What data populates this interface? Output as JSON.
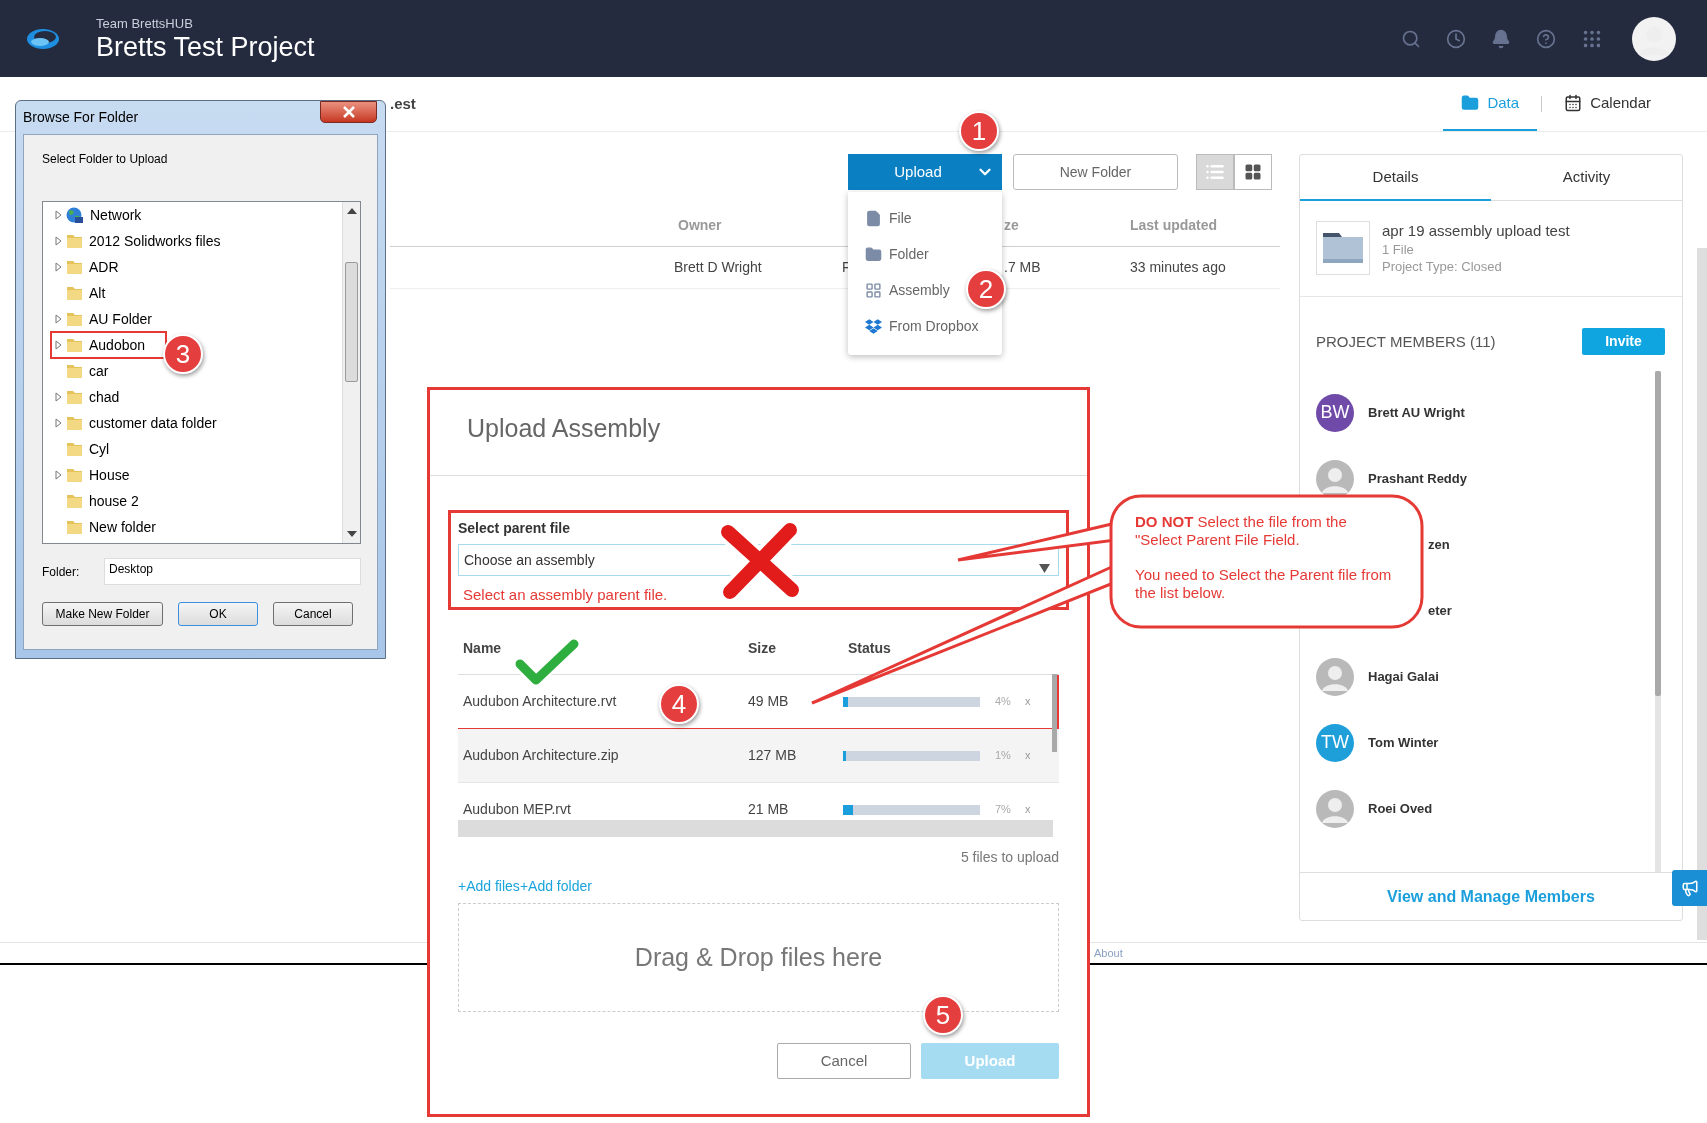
{
  "header": {
    "team": "Team BrettsHUB",
    "project": "Bretts Test Project"
  },
  "subheader": {
    "title_fragment": ".est",
    "tabs": [
      {
        "label": "Data",
        "selected": true
      },
      {
        "label": "Calendar",
        "selected": false
      }
    ]
  },
  "toolbar": {
    "upload": "Upload",
    "new_folder": "New Folder",
    "views": [
      {
        "kind": "list",
        "selected": true
      },
      {
        "kind": "grid",
        "selected": false
      }
    ]
  },
  "upload_menu": [
    {
      "kind": "file",
      "label": "File"
    },
    {
      "kind": "folder",
      "label": "Folder"
    },
    {
      "kind": "assembly",
      "label": "Assembly"
    },
    {
      "kind": "dropbox",
      "label": "From Dropbox"
    }
  ],
  "table": {
    "columns": [
      "Owner",
      "",
      "ze",
      "Last updated"
    ],
    "rows": [
      {
        "cells": [
          "Brett D Wright",
          "F",
          ".7 MB",
          "33 minutes ago"
        ]
      }
    ]
  },
  "details_panel": {
    "tabs": [
      {
        "label": "Details",
        "selected": true
      },
      {
        "label": "Activity",
        "selected": false
      }
    ],
    "item": {
      "title": "apr 19 assembly upload test",
      "files": "1 File",
      "type": "Project Type: Closed"
    },
    "members_heading": "PROJECT MEMBERS (11)",
    "invite": "Invite",
    "members": [
      {
        "name": "Brett AU Wright",
        "kind": "initials",
        "initials": "BW",
        "color": "#6f4aa8"
      },
      {
        "name": "Prashant Reddy",
        "kind": "photo"
      },
      {
        "name": "zen",
        "kind": "covered"
      },
      {
        "name": "eter",
        "kind": "covered"
      },
      {
        "name": "Hagai Galai",
        "kind": "photo"
      },
      {
        "name": "Tom Winter",
        "kind": "initials",
        "initials": "TW",
        "color": "#1e9fd9"
      },
      {
        "name": "Roei Oved",
        "kind": "photo"
      }
    ],
    "manage_link": "View and Manage Members"
  },
  "browse_dialog": {
    "title": "Browse For Folder",
    "prompt": "Select Folder to Upload",
    "tree": [
      {
        "label": "Network",
        "kind": "network",
        "expandable": true,
        "marked": false
      },
      {
        "label": "2012 Solidworks files",
        "kind": "folder",
        "expandable": true,
        "marked": false
      },
      {
        "label": "ADR",
        "kind": "folder",
        "expandable": true,
        "marked": false
      },
      {
        "label": "Alt",
        "kind": "folder",
        "expandable": false,
        "marked": false
      },
      {
        "label": "AU Folder",
        "kind": "folder",
        "expandable": true,
        "marked": false
      },
      {
        "label": "Audobon",
        "kind": "folder",
        "expandable": true,
        "marked": true
      },
      {
        "label": "car",
        "kind": "folder",
        "expandable": false,
        "marked": false
      },
      {
        "label": "chad",
        "kind": "folder",
        "expandable": true,
        "marked": false
      },
      {
        "label": "customer data folder",
        "kind": "folder",
        "expandable": true,
        "marked": false
      },
      {
        "label": "Cyl",
        "kind": "folder",
        "expandable": false,
        "marked": false
      },
      {
        "label": "House",
        "kind": "folder",
        "expandable": true,
        "marked": false
      },
      {
        "label": "house 2",
        "kind": "folder",
        "expandable": false,
        "marked": false
      },
      {
        "label": "New folder",
        "kind": "folder",
        "expandable": false,
        "marked": false
      }
    ],
    "folder_label": "Folder:",
    "folder_value": "Desktop",
    "buttons": [
      {
        "label": "Make New Folder",
        "default": false
      },
      {
        "label": "OK",
        "default": true
      },
      {
        "label": "Cancel",
        "default": false
      }
    ]
  },
  "upload_dialog": {
    "title": "Upload Assembly",
    "parent_label": "Select parent file",
    "parent_placeholder": "Choose an assembly",
    "error": "Select an assembly parent file.",
    "columns": [
      "Name",
      "Size",
      "Status"
    ],
    "files": [
      {
        "name": "Audubon Architecture.rvt",
        "size": "49 MB",
        "level": 0.04,
        "percent": "4%",
        "remove": "x",
        "marked": true
      },
      {
        "name": "Audubon Architecture.zip",
        "size": "127 MB",
        "level": 0.01,
        "percent": "1%",
        "remove": "x",
        "marked": false
      },
      {
        "name": "Audubon MEP.rvt",
        "size": "21 MB",
        "level": 0.07,
        "percent": "7%",
        "remove": "x",
        "marked": false
      }
    ],
    "count": "5 files to upload",
    "add_links": [
      "+Add files",
      "+Add folder"
    ],
    "dropzone": "Drag & Drop files here",
    "buttons": [
      {
        "label": "Cancel",
        "kind": "secondary",
        "disabled": false
      },
      {
        "label": "Upload",
        "kind": "primary",
        "disabled": true
      }
    ]
  },
  "callout": {
    "paragraphs": [
      "**DO NOT** Select the file from the \"Select Parent File Field.",
      "You need to Select the Parent file from the list below."
    ]
  },
  "badges": [
    "1",
    "2",
    "3",
    "4",
    "5"
  ],
  "footer": {
    "link": "About"
  }
}
